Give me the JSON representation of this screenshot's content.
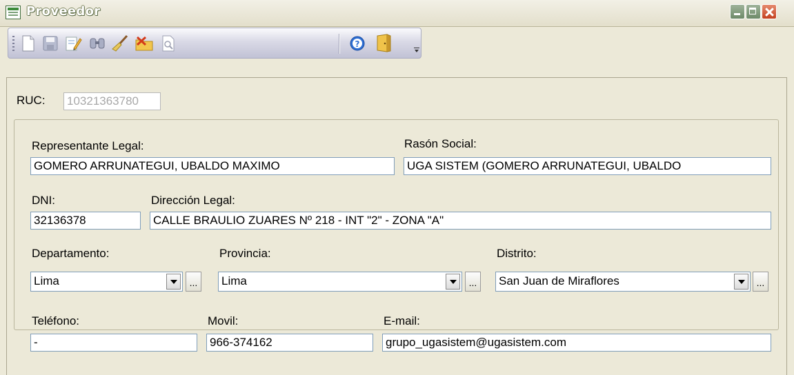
{
  "window": {
    "title": "Proveedor"
  },
  "toolbar": {
    "buttons": [
      {
        "name": "new",
        "glyph": "🗋"
      },
      {
        "name": "save",
        "glyph": "💾"
      },
      {
        "name": "edit",
        "glyph": "📝"
      },
      {
        "name": "find",
        "glyph": "🔍"
      },
      {
        "name": "clean",
        "glyph": "🧹"
      },
      {
        "name": "delete",
        "glyph": "📂"
      },
      {
        "name": "preview",
        "glyph": "🗎"
      },
      {
        "name": "help",
        "glyph": "❓"
      },
      {
        "name": "exit",
        "glyph": "🚪"
      }
    ]
  },
  "form": {
    "ruc_label": "RUC:",
    "ruc_value": "10321363780",
    "rep_legal_label": "Representante Legal:",
    "rep_legal_value": "GOMERO ARRUNATEGUI, UBALDO MAXIMO",
    "razon_social_label": "Rasón Social:",
    "razon_social_value": "UGA SISTEM (GOMERO ARRUNATEGUI, UBALDO",
    "dni_label": "DNI:",
    "dni_value": "32136378",
    "direccion_label": "Dirección Legal:",
    "direccion_value": "CALLE BRAULIO ZUARES Nº 218 - INT \"2\" - ZONA \"A\"",
    "departamento_label": "Departamento:",
    "departamento_value": "Lima",
    "provincia_label": "Provincia:",
    "provincia_value": "Lima",
    "distrito_label": "Distrito:",
    "distrito_value": "San Juan de Miraflores",
    "ellipsis": "...",
    "telefono_label": "Teléfono:",
    "telefono_value": "-",
    "movil_label": "Movil:",
    "movil_value": "966-374162",
    "email_label": "E-mail:",
    "email_value": "grupo_ugasistem@ugasistem.com"
  }
}
